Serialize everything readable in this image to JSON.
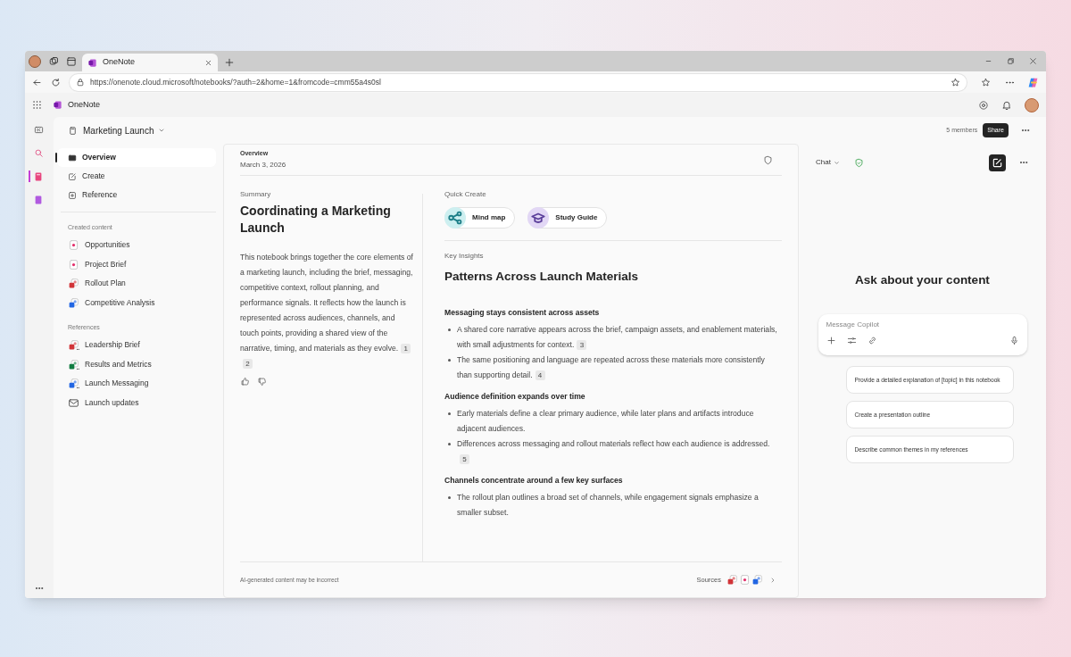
{
  "browser": {
    "tab": {
      "title": "OneNote",
      "selected": true
    },
    "url": "https://onenote.cloud.microsoft/notebooks/?auth=2&home=1&fromcode=cmm55a4s0sl"
  },
  "app": {
    "name": "OneNote"
  },
  "rail": [
    {
      "kind": "panel",
      "selected": false
    },
    {
      "kind": "search",
      "selected": false
    },
    {
      "kind": "notebook",
      "selected": true
    },
    {
      "kind": "book",
      "selected": false
    }
  ],
  "notebook": {
    "title": "Marketing Launch",
    "members": "5 members",
    "share": "Share"
  },
  "nav": [
    {
      "label": "Overview",
      "kind": "overview",
      "selected": true
    },
    {
      "label": "Create",
      "kind": "create",
      "selected": false
    },
    {
      "label": "Reference",
      "kind": "reference",
      "selected": false
    }
  ],
  "nav_sections": [
    {
      "heading": "Created content",
      "items": [
        {
          "label": "Opportunities",
          "kind": "page"
        },
        {
          "label": "Project Brief",
          "kind": "page"
        },
        {
          "label": "Rollout Plan",
          "kind": "red"
        },
        {
          "label": "Competitive Analysis",
          "kind": "blue"
        }
      ]
    },
    {
      "heading": "References",
      "items": [
        {
          "label": "Leadership Brief",
          "kind": "red-shared"
        },
        {
          "label": "Results and Metrics",
          "kind": "green-shared"
        },
        {
          "label": "Launch Messaging",
          "kind": "blue-shared"
        },
        {
          "label": "Launch updates",
          "kind": "mail"
        }
      ]
    }
  ],
  "page": {
    "label": "Overview",
    "date": "March 3, 2026",
    "summary": {
      "label": "Summary",
      "title": "Coordinating a Marketing Launch",
      "text": "This notebook brings together the core elements of a marketing launch, including the brief, messaging, competitive context, rollout planning, and performance signals. It reflects how the launch is represented across audiences, channels, and touch points, providing a shared view of the narrative, timing, and materials as they evolve.",
      "citations": [
        "1",
        "2"
      ]
    },
    "quick_create": {
      "label": "Quick Create",
      "items": [
        {
          "label": "Mind map",
          "kind": "mindmap"
        },
        {
          "label": "Study Guide",
          "kind": "study"
        }
      ]
    },
    "insights": {
      "label": "Key Insights",
      "title": "Patterns Across Launch Materials",
      "sections": [
        {
          "heading": "Messaging stays consistent across assets",
          "bullets": [
            {
              "text": "A shared core narrative appears across the brief, campaign assets, and enablement materials, with small adjustments for context.",
              "citations": [
                "3"
              ]
            },
            {
              "text": "The same positioning and language are repeated across these materials more consistently than supporting detail.",
              "citations": [
                "4"
              ]
            }
          ]
        },
        {
          "heading": "Audience definition expands over time",
          "bullets": [
            {
              "text": "Early materials define a clear primary audience, while later plans and artifacts introduce adjacent audiences."
            },
            {
              "text": "Differences across messaging and rollout materials reflect how each audience is addressed.",
              "citations": [
                "5"
              ]
            }
          ]
        },
        {
          "heading": "Channels concentrate around a few key surfaces",
          "bullets": [
            {
              "text": "The rollout plan outlines a broad set of channels, while engagement signals emphasize a smaller subset."
            }
          ]
        }
      ]
    },
    "disclaimer": "AI-generated content may be incorrect",
    "sources": {
      "label": "Sources",
      "icons": [
        {
          "kind": "red"
        },
        {
          "kind": "page"
        },
        {
          "kind": "blue"
        }
      ]
    }
  },
  "chat": {
    "label": "Chat",
    "heading": "Ask about your content",
    "placeholder": "Message Copilot",
    "suggestions": [
      "Provide a detailed explanation of [topic] in this notebook",
      "Create a presentation outline",
      "Describe common themes in my references"
    ]
  }
}
